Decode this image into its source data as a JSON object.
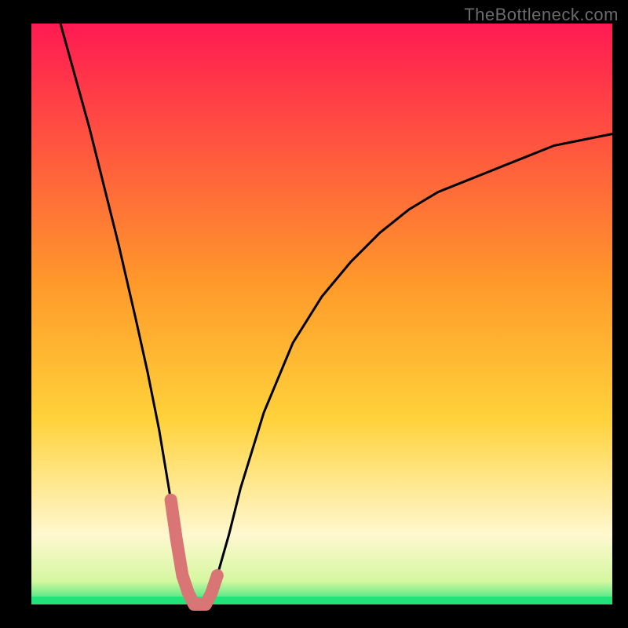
{
  "watermark": "TheBottleneck.com",
  "colors": {
    "frame": "#000000",
    "curve_stroke": "#000000",
    "highlight_stroke": "#d97575",
    "bottom_band": "#22e37a",
    "grad_top": "#ff1a52",
    "grad_mid": "#ffd23a",
    "grad_low": "#fff8d0",
    "grad_bottom": "#22e37a"
  },
  "chart_data": {
    "type": "line",
    "title": "",
    "xlabel": "",
    "ylabel": "",
    "xlim": [
      0,
      100
    ],
    "ylim": [
      0,
      100
    ],
    "comment": "V-shaped bottleneck curve; values are approximate pixel-to-percent readings of the plotted black curve within the colored plot area.",
    "x": [
      5,
      10,
      15,
      18,
      20,
      22,
      24,
      25,
      26,
      27,
      28,
      29,
      30,
      31,
      32,
      34,
      36,
      40,
      45,
      50,
      55,
      60,
      65,
      70,
      75,
      80,
      85,
      90,
      95,
      100
    ],
    "y": [
      100,
      82,
      62,
      49,
      40,
      30,
      18,
      11,
      5,
      2,
      0,
      0,
      0,
      2,
      5,
      12,
      20,
      33,
      45,
      53,
      59,
      64,
      68,
      71,
      73,
      75,
      77,
      79,
      80,
      81
    ],
    "highlight_range_x": [
      24,
      33
    ],
    "highlight_comment": "Thick salmon segment near the minimum (approx x=24..33, y<=12)"
  }
}
